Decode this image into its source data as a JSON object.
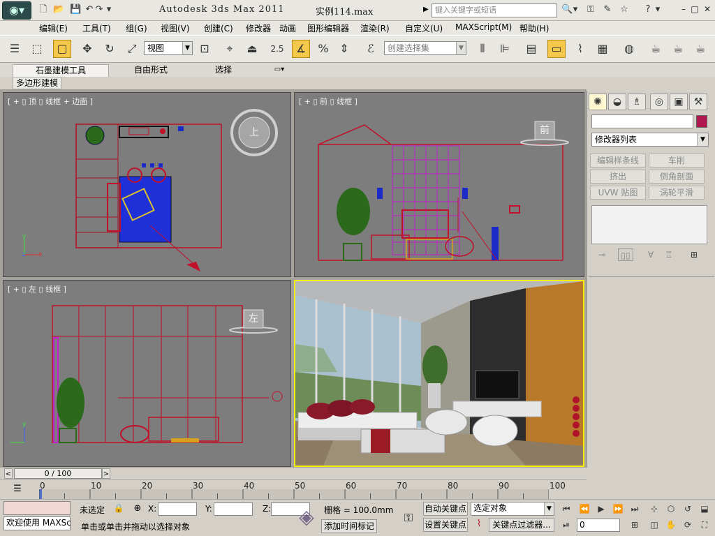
{
  "titlebar": {
    "app_title": "Autodesk 3ds Max  2011",
    "file_name": "实例114.max",
    "search_placeholder": "键入关键字或短语"
  },
  "menu": [
    "编辑(E)",
    "工具(T)",
    "组(G)",
    "视图(V)",
    "创建(C)",
    "修改器",
    "动画",
    "图形编辑器",
    "渲染(R)",
    "自定义(U)",
    "MAXScript(M)",
    "帮助(H)"
  ],
  "toolbar": {
    "view_dropdown": "视图",
    "snap_value": "2.5",
    "selection_set_placeholder": "创建选择集"
  },
  "ribbon": {
    "tabs": [
      "石墨建模工具",
      "自由形式",
      "选择"
    ],
    "sub_tab": "多边形建模"
  },
  "viewports": {
    "top": {
      "label": "[ + ▯ 顶 ▯ 线框 + 边面 ]",
      "cube": "上"
    },
    "front": {
      "label": "[ + ▯ 前 ▯ 线框 ]",
      "cube": "前"
    },
    "left": {
      "label": "[ + ▯ 左 ▯ 线框 ]",
      "cube": "左"
    },
    "perspective": {
      "active": true
    }
  },
  "command_panel": {
    "modifier_list": "修改器列表",
    "object_color": "#b0174f",
    "buttons": [
      "编辑样条线",
      "车削",
      "挤出",
      "倒角剖面",
      "UVW 贴图",
      "涡轮平滑"
    ]
  },
  "timeline": {
    "frame_display": "0 / 100",
    "current_frame": 0,
    "total_frames": 100,
    "ticks": [
      "0",
      "10",
      "20",
      "30",
      "40",
      "50",
      "60",
      "70",
      "80",
      "90",
      "100"
    ]
  },
  "status": {
    "maxscript_prompt": "欢迎使用 MAXSc",
    "selection_state": "未选定",
    "x_label": "X:",
    "y_label": "Y:",
    "z_label": "Z:",
    "grid": "栅格 = 100.0mm",
    "auto_key": "自动关键点",
    "set_key": "设置关键点",
    "key_mode_select": "选定对象",
    "key_filters": "关键点过滤器...",
    "prompt": "单击或单击并拖动以选择对象",
    "add_time_tag": "添加时间标记",
    "frame_field": "0"
  }
}
